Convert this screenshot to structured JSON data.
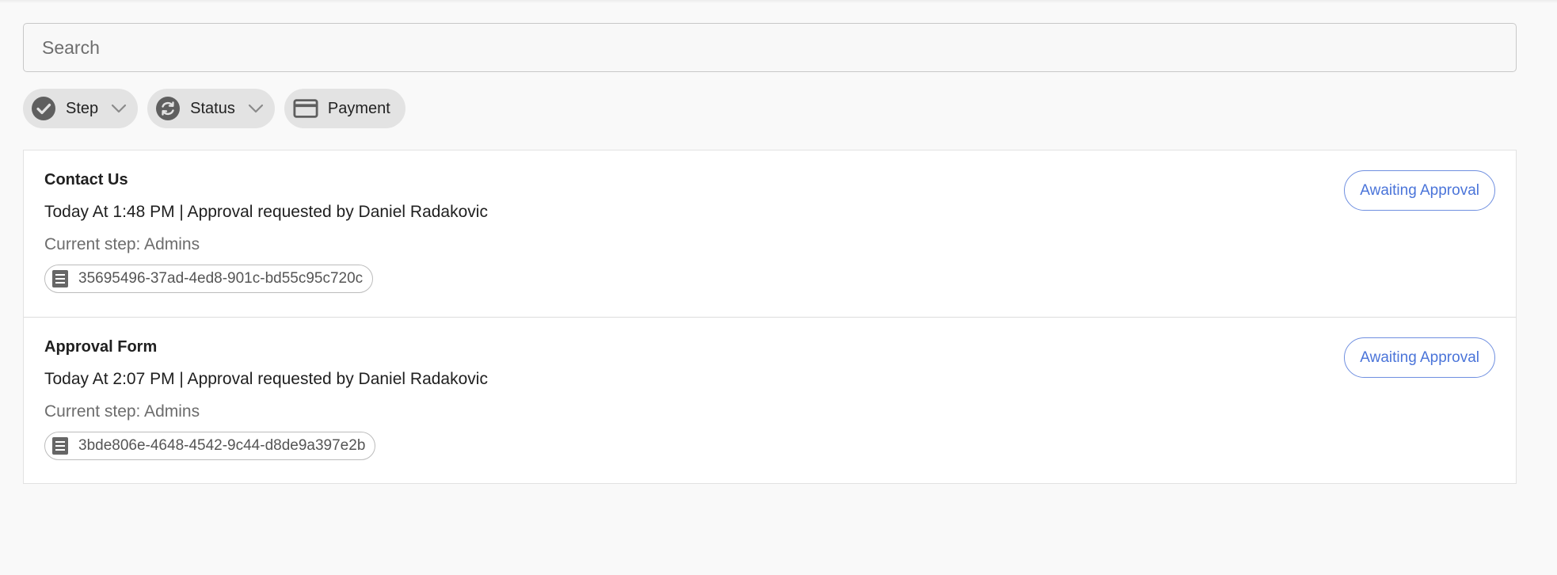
{
  "search": {
    "placeholder": "Search"
  },
  "filters": [
    {
      "label": "Step",
      "icon": "check-circle-icon",
      "has_dropdown": true
    },
    {
      "label": "Status",
      "icon": "sync-icon",
      "has_dropdown": true
    },
    {
      "label": "Payment",
      "icon": "credit-card-icon",
      "has_dropdown": false
    }
  ],
  "items": [
    {
      "title": "Contact Us",
      "meta": "Today At 1:48 PM | Approval requested by Daniel Radakovic",
      "step": "Current step: Admins",
      "id": "35695496-37ad-4ed8-901c-bd55c95c720c",
      "status": "Awaiting Approval"
    },
    {
      "title": "Approval Form",
      "meta": "Today At 2:07 PM | Approval requested by Daniel Radakovic",
      "step": "Current step: Admins",
      "id": "3bde806e-4648-4542-9c44-d8de9a397e2b",
      "status": "Awaiting Approval"
    }
  ],
  "colors": {
    "background": "#f9f9f9",
    "chip": "#e3e3e3",
    "badge_accent": "#4a74d9",
    "icon": "#5f5f5f"
  }
}
